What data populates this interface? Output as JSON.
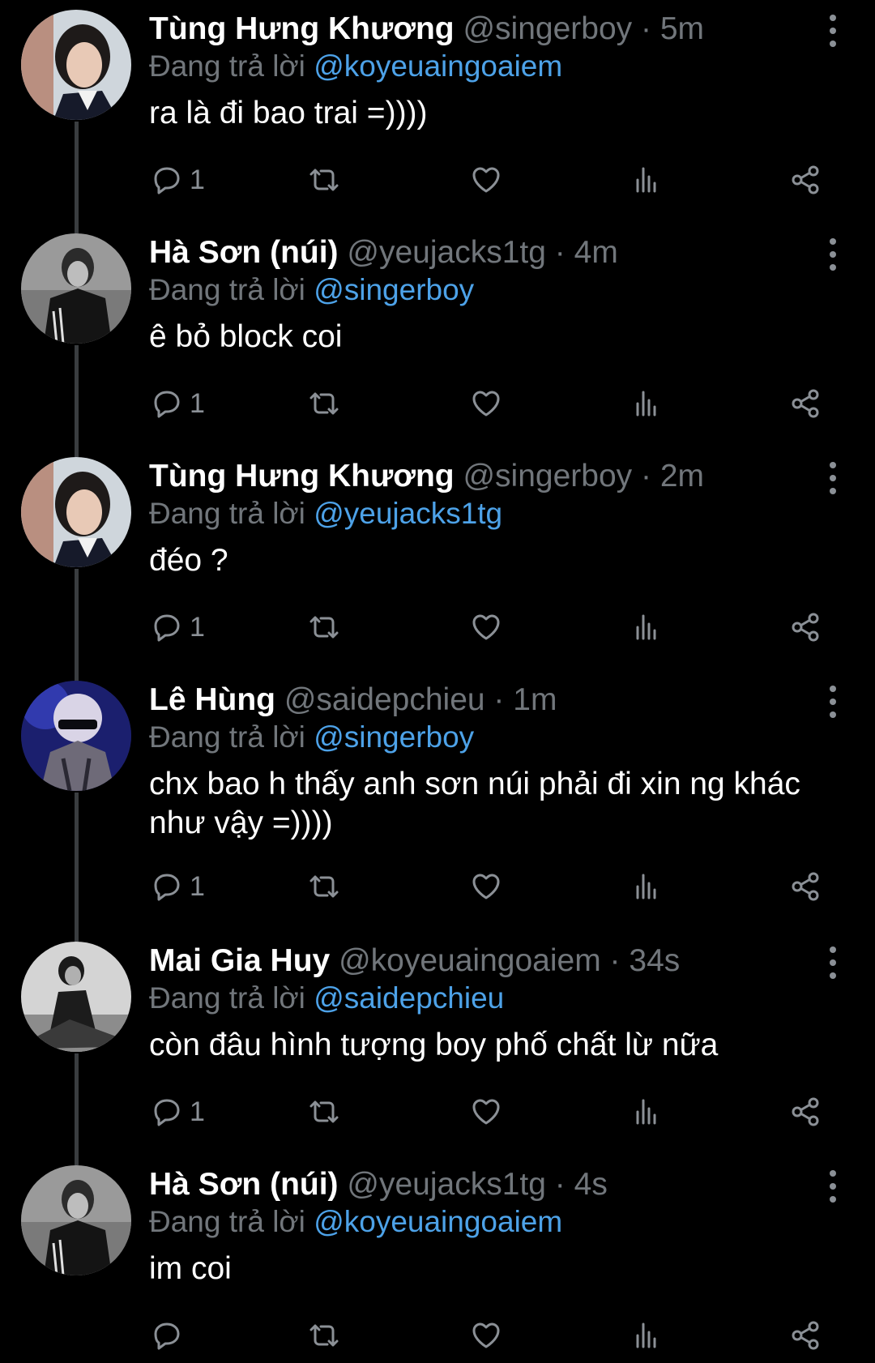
{
  "replying_prefix": "Đang trả lời",
  "separator": "·",
  "colors": {
    "background": "#000000",
    "name": "#ffffff",
    "muted": "#71767b",
    "mention": "#4da2e8",
    "rail": "#3a3d40"
  },
  "tweets": [
    {
      "name": "Tùng Hưng Khương",
      "handle": "@singerboy",
      "time": "5m",
      "replying_to": "@koyeuaingoaiem",
      "text_lines": [
        "ra là đi bao trai =))))"
      ],
      "reply_count": "1",
      "avatar_icon": "avatar-photo-icon"
    },
    {
      "name": "Hà Sơn (núi)",
      "handle": "@yeujacks1tg",
      "time": "4m",
      "replying_to": "@singerboy",
      "text_lines": [
        "ê bỏ block coi"
      ],
      "reply_count": "1",
      "avatar_icon": "avatar-photo-icon"
    },
    {
      "name": "Tùng Hưng Khương",
      "handle": "@singerboy",
      "time": "2m",
      "replying_to": "@yeujacks1tg",
      "text_lines": [
        "đéo ?"
      ],
      "reply_count": "1",
      "avatar_icon": "avatar-photo-icon"
    },
    {
      "name": "Lê Hùng",
      "handle": "@saidepchieu",
      "time": "1m",
      "replying_to": "@singerboy",
      "text_lines": [
        "chx bao h thấy anh sơn núi phải đi xin ng khác",
        "như vậy =))))"
      ],
      "reply_count": "1",
      "avatar_icon": "avatar-photo-icon"
    },
    {
      "name": "Mai Gia Huy",
      "handle": "@koyeuaingoaiem",
      "time": "34s",
      "replying_to": "@saidepchieu",
      "text_lines": [
        "còn đâu hình tượng boy phố chất lừ nữa"
      ],
      "reply_count": "1",
      "avatar_icon": "avatar-photo-icon"
    },
    {
      "name": "Hà Sơn (núi)",
      "handle": "@yeujacks1tg",
      "time": "4s",
      "replying_to": "@koyeuaingoaiem",
      "text_lines": [
        "im coi"
      ],
      "reply_count": "",
      "avatar_icon": "avatar-photo-icon"
    }
  ]
}
